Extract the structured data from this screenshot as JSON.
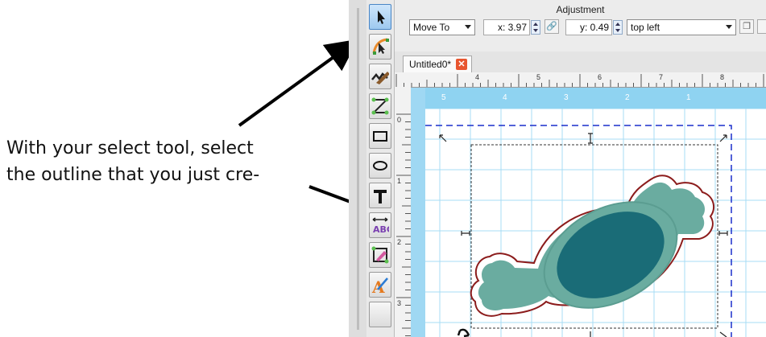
{
  "annotation": {
    "line1": "With your select tool, select",
    "line2": "the outline that you just cre-"
  },
  "adjustment": {
    "title": "Adjustment",
    "mode": "Move To",
    "x_value": "x: 3.97",
    "y_value": "y: 0.49",
    "anchor": "top left"
  },
  "tab": {
    "label": "Untitled0*",
    "close_glyph": "✕"
  },
  "rulers": {
    "top_numbers": [
      "4",
      "5",
      "6",
      "7",
      "8"
    ],
    "left_numbers": [
      "0",
      "1",
      "2",
      "3"
    ]
  },
  "mat_numbers": [
    "5",
    "4",
    "3",
    "2",
    "1"
  ],
  "tools": [
    "select-tool",
    "node-edit-tool",
    "knife-tool",
    "line-tool",
    "rectangle-tool",
    "ellipse-tool",
    "text-tool",
    "text-on-path-tool",
    "weld-tool",
    "draw-tool"
  ],
  "colors": {
    "shape_dark": "#1a6c77",
    "shape_light": "#6aaca0",
    "outline": "#8c1c1c",
    "mat_blue": "#8fd3f1",
    "page_guide": "#1a2fcc"
  }
}
